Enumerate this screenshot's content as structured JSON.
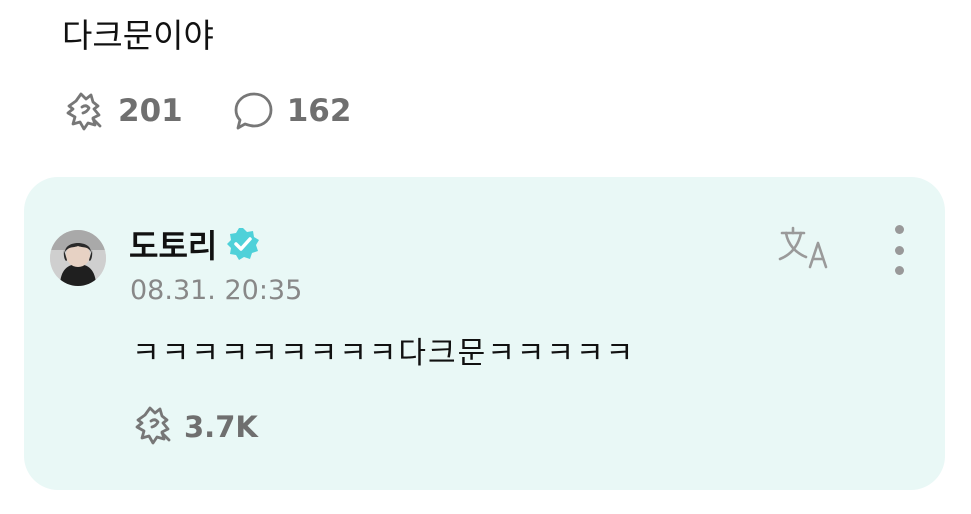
{
  "post": {
    "text": "다크문이야",
    "likes": "201",
    "comments": "162"
  },
  "reply": {
    "author": "도토리",
    "verified": true,
    "timestamp": "08.31. 20:35",
    "text": "ㅋㅋㅋㅋㅋㅋㅋㅋㅋ다크문ㅋㅋㅋㅋㅋ",
    "likes": "3.7K",
    "card_color": "#e9f8f6",
    "verified_color": "#4fd1d9"
  },
  "icons": {
    "like": "heart-hand-icon",
    "comment": "speech-bubble-icon",
    "translate": "translate-icon",
    "more": "more-vertical-icon",
    "verified": "verified-badge-icon"
  }
}
